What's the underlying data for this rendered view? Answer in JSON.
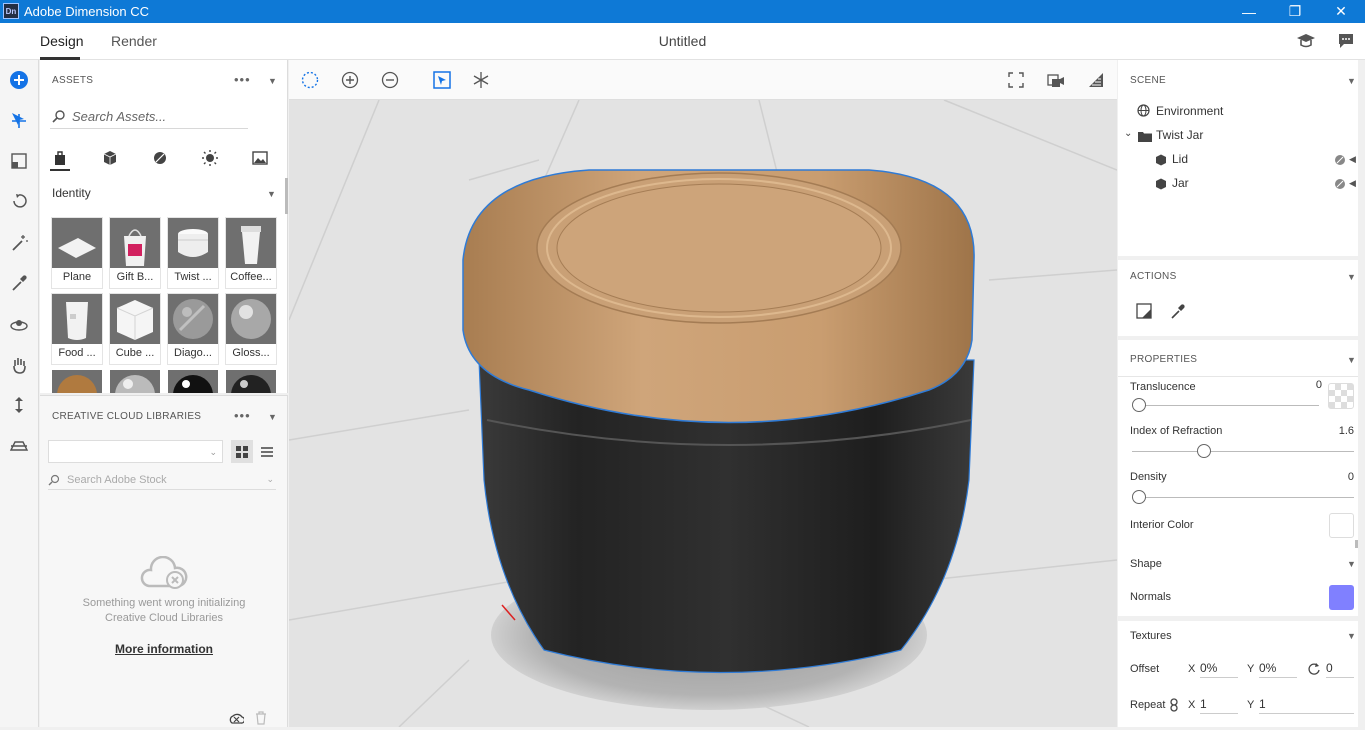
{
  "titlebar": {
    "logo": "Dn",
    "title": "Adobe Dimension CC",
    "minimize": "—",
    "restore": "❐",
    "close": "✕"
  },
  "menubar": {
    "tabs": [
      {
        "label": "Design"
      },
      {
        "label": "Render"
      }
    ],
    "doc_title": "Untitled"
  },
  "assets": {
    "title": "ASSETS",
    "more": "•••",
    "search_placeholder": "Search Assets...",
    "section": "Identity",
    "items": [
      {
        "label": "Plane"
      },
      {
        "label": "Gift B..."
      },
      {
        "label": "Twist ..."
      },
      {
        "label": "Coffee..."
      },
      {
        "label": "Food ..."
      },
      {
        "label": "Cube ..."
      },
      {
        "label": "Diago..."
      },
      {
        "label": "Gloss..."
      }
    ]
  },
  "cclib": {
    "title": "CREATIVE CLOUD LIBRARIES",
    "more": "•••",
    "search_placeholder": "Search Adobe Stock",
    "error_line1": "Something went wrong initializing",
    "error_line2": "Creative Cloud Libraries",
    "more_info": "More information"
  },
  "scene": {
    "title": "SCENE",
    "environment": "Environment",
    "group": "Twist Jar",
    "children": [
      {
        "label": "Lid"
      },
      {
        "label": "Jar"
      }
    ]
  },
  "actions": {
    "title": "ACTIONS"
  },
  "properties": {
    "title": "PROPERTIES",
    "translucence": {
      "label": "Translucence",
      "value": "0",
      "fraction": 0
    },
    "ior": {
      "label": "Index of Refraction",
      "value": "1.6",
      "fraction": 0.3
    },
    "density": {
      "label": "Density",
      "value": "0",
      "fraction": 0
    },
    "interior_color": {
      "label": "Interior Color",
      "color": "#ffffff"
    },
    "shape": {
      "title": "Shape",
      "normals_label": "Normals",
      "normals_color": "#8080ff"
    },
    "textures": {
      "title": "Textures",
      "offset_label": "Offset",
      "x_label": "X",
      "x_value": "0%",
      "y_label": "Y",
      "y_value": "0%",
      "rotation_value": "0",
      "repeat_label": "Repeat",
      "rx_label": "X",
      "rx_value": "1",
      "ry_label": "Y",
      "ry_value": "1"
    }
  },
  "colors": {
    "titlebar": "#0e79d6",
    "accent": "#1473e6",
    "lid": "#c49a6c",
    "jar": "#2a2a2a"
  }
}
